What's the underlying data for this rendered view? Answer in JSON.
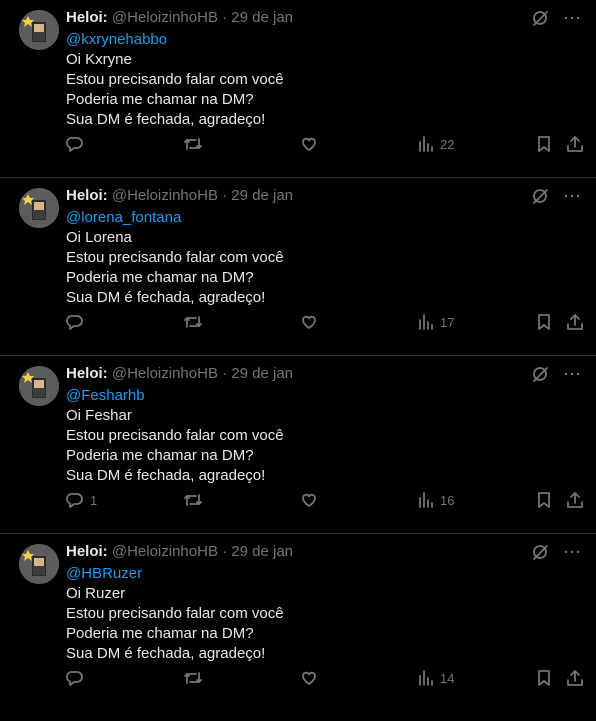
{
  "tweets": [
    {
      "author_name": "Heloi:",
      "handle": "@HeloizinhoHB",
      "separator": "·",
      "date": "29 de jan",
      "mention": "@kxrynehabbo",
      "lines": [
        "Oi Kxryne",
        "Estou precisando falar com você",
        "Poderia me chamar na DM?",
        "Sua DM é fechada, agradeço!"
      ],
      "reply_count": "",
      "views": "22"
    },
    {
      "author_name": "Heloi:",
      "handle": "@HeloizinhoHB",
      "separator": "·",
      "date": "29 de jan",
      "mention": "@lorena_fontana",
      "lines": [
        "Oi Lorena",
        "Estou precisando falar com você",
        "Poderia me chamar na DM?",
        "Sua DM é fechada, agradeço!"
      ],
      "reply_count": "",
      "views": "17"
    },
    {
      "author_name": "Heloi:",
      "handle": "@HeloizinhoHB",
      "separator": "·",
      "date": "29 de jan",
      "mention": "@Fesharhb",
      "lines": [
        "Oi Feshar",
        "Estou precisando falar com você",
        "Poderia me chamar na DM?",
        "Sua DM é fechada, agradeço!"
      ],
      "reply_count": "1",
      "views": "16"
    },
    {
      "author_name": "Heloi:",
      "handle": "@HeloizinhoHB",
      "separator": "·",
      "date": "29 de jan",
      "mention": "@HBRuzer",
      "lines": [
        "Oi Ruzer",
        "Estou precisando falar com você",
        "Poderia me chamar na DM?",
        "Sua DM é fechada, agradeço!"
      ],
      "reply_count": "",
      "views": "14"
    }
  ],
  "icons": {
    "grok": "grok-icon",
    "more": "more-icon",
    "reply": "reply-icon",
    "retweet": "retweet-icon",
    "like": "like-icon",
    "views": "views-icon",
    "bookmark": "bookmark-icon",
    "share": "share-icon"
  },
  "colors": {
    "background": "#000000",
    "text": "#e7e9ea",
    "muted": "#71767b",
    "link": "#1d9bf0",
    "divider": "#2f3336"
  }
}
